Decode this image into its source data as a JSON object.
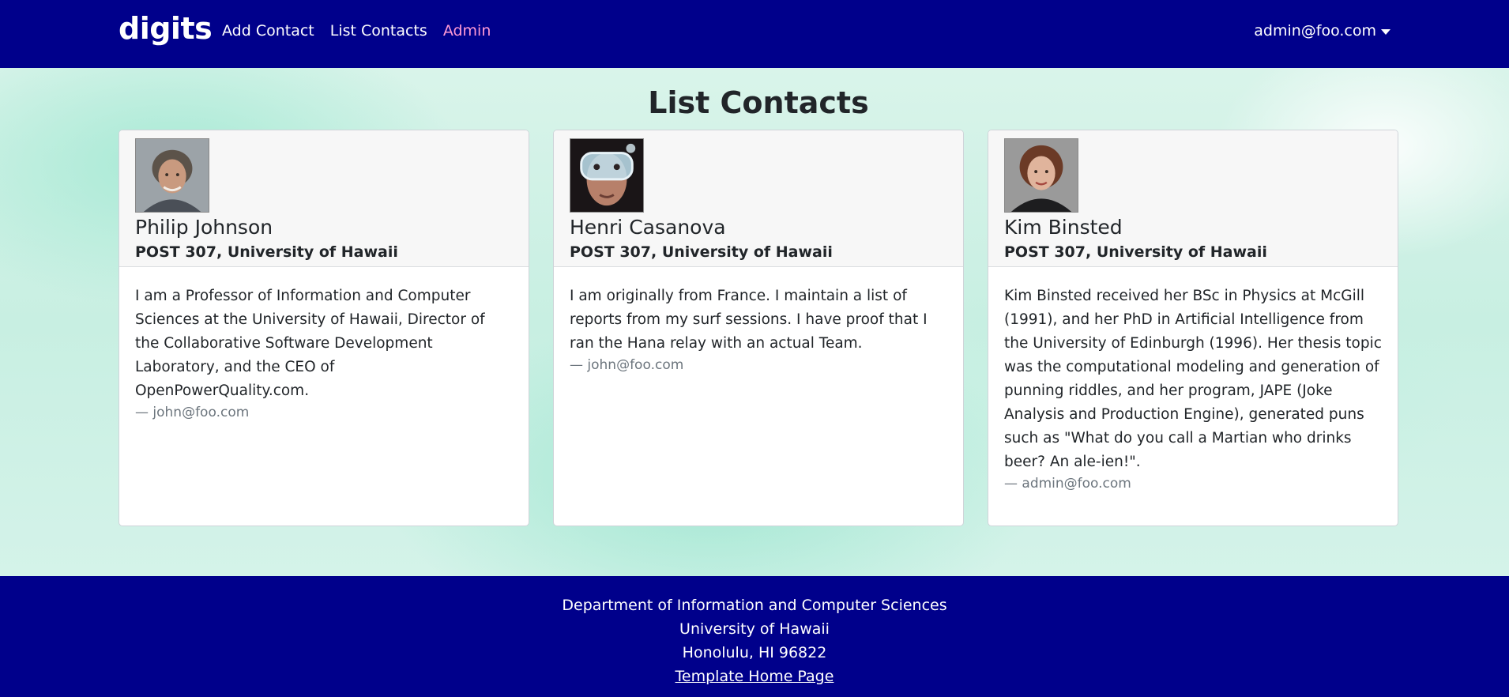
{
  "navbar": {
    "brand": "digits",
    "links": [
      {
        "label": "Add Contact"
      },
      {
        "label": "List Contacts"
      },
      {
        "label": "Admin"
      }
    ],
    "user": "admin@foo.com"
  },
  "page": {
    "title": "List Contacts"
  },
  "contacts": [
    {
      "name": "Philip Johnson",
      "address": "POST 307, University of Hawaii",
      "description": "I am a Professor of Information and Computer Sciences at the University of Hawaii, Director of the Collaborative Software Development Laboratory, and the CEO of OpenPowerQuality.com.",
      "owner": "— john@foo.com"
    },
    {
      "name": "Henri Casanova",
      "address": "POST 307, University of Hawaii",
      "description": "I am originally from France. I maintain a list of reports from my surf sessions. I have proof that I ran the Hana relay with an actual Team.",
      "owner": "— john@foo.com"
    },
    {
      "name": "Kim Binsted",
      "address": "POST 307, University of Hawaii",
      "description": "Kim Binsted received her BSc in Physics at McGill (1991), and her PhD in Artificial Intelligence from the University of Edinburgh (1996). Her thesis topic was the computational modeling and generation of punning riddles, and her program, JAPE (Joke Analysis and Production Engine), generated puns such as \"What do you call a Martian who drinks beer? An ale-ien!\".",
      "owner": "— admin@foo.com"
    }
  ],
  "footer": {
    "line1": "Department of Information and Computer Sciences",
    "line2": "University of Hawaii",
    "line3": "Honolulu, HI 96822",
    "link": "Template Home Page"
  },
  "colors": {
    "navbar": "#00008b",
    "active_link": "#ff9ad5",
    "footer": "#00008b"
  }
}
